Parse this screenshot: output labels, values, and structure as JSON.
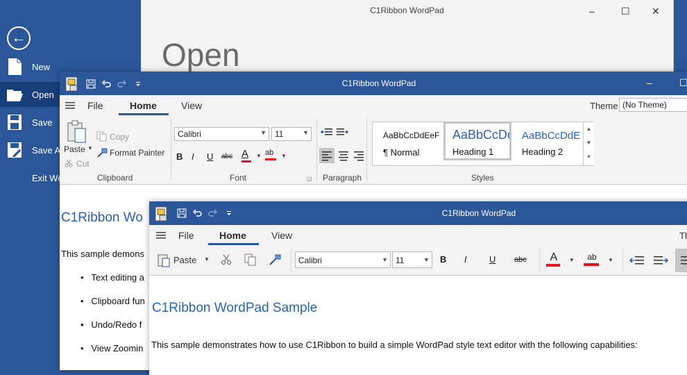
{
  "backstage": {
    "title": "C1Ribbon WordPad",
    "heading": "Open",
    "back_glyph": "←",
    "window_buttons": {
      "minimize": "–",
      "maximize": "☐",
      "close": "✕"
    },
    "menu": [
      {
        "label": "New",
        "icon": "new-document-icon",
        "selected": false
      },
      {
        "label": "Open",
        "icon": "open-folder-icon",
        "selected": true
      },
      {
        "label": "Save",
        "icon": "save-icon",
        "selected": false
      },
      {
        "label": "Save A",
        "icon": "save-as-icon",
        "selected": false
      },
      {
        "label": "Exit Wo",
        "icon": "",
        "selected": false
      }
    ]
  },
  "window2": {
    "title": "C1Ribbon WordPad",
    "tabs": [
      "File",
      "Home",
      "View"
    ],
    "selected_tab": "Home",
    "theme_label": "Theme",
    "theme_value": "(No Theme)",
    "clipboard": {
      "paste": "Paste",
      "copy": "Copy",
      "cut": "Cut",
      "format_painter": "Format Painter",
      "group": "Clipboard"
    },
    "font": {
      "name": "Calibri",
      "size": "11",
      "group": "Font",
      "bold": "B",
      "italic": "I",
      "underline": "U",
      "strike": "abc",
      "font_color": "A",
      "highlight": "ab"
    },
    "paragraph": {
      "group": "Paragraph"
    },
    "styles": {
      "group": "Styles",
      "items": [
        {
          "preview": "AaBbCcDdEeF",
          "name": "¶ Normal",
          "selected": false
        },
        {
          "preview": "AaBbCcDd",
          "name": "Heading 1",
          "selected": true
        },
        {
          "preview": "AaBbCcDdE",
          "name": "Heading 2",
          "selected": false
        }
      ]
    },
    "doc": {
      "heading": "C1Ribbon Wo",
      "intro": "This sample demons",
      "bullets": [
        "Text editing a",
        "Clipboard fun",
        "Undo/Redo f",
        "View Zoomin"
      ]
    }
  },
  "window3": {
    "title": "C1Ribbon WordPad",
    "tabs": [
      "File",
      "Home",
      "View"
    ],
    "selected_tab": "Home",
    "theme_partial": "Th",
    "paste": "Paste",
    "font_name": "Calibri",
    "font_size": "11",
    "bold": "B",
    "italic": "I",
    "underline": "U",
    "strike": "abc",
    "font_color": "A",
    "highlight": "ab",
    "doc": {
      "heading": "C1Ribbon WordPad Sample",
      "intro": "This sample demonstrates how to use C1Ribbon to build a simple WordPad style text editor with the following capabilities:"
    }
  },
  "colors": {
    "accent": "#2b579a",
    "heading": "#2b62b5",
    "font_color_bar": "#e81123",
    "highlight_bar": "#e81123"
  }
}
